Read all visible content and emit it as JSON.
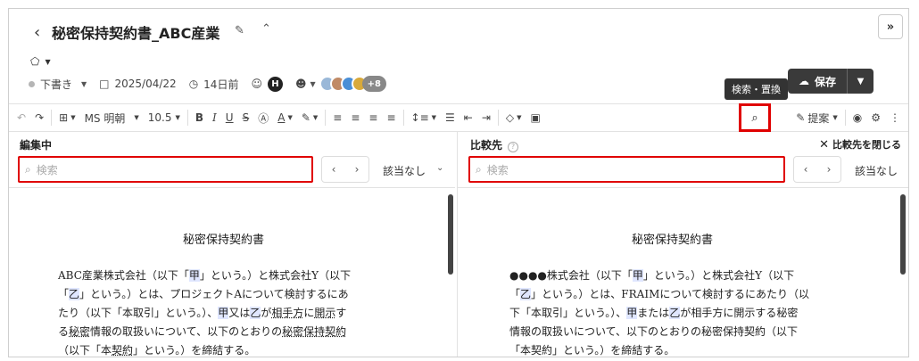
{
  "header": {
    "back_icon": "chevron-left-icon",
    "title": "秘密保持契約書_ABC産業",
    "expand_label": "»"
  },
  "meta": {
    "status": "下書き",
    "date": "2025/04/22",
    "relative": "14日前",
    "owner_initial": "H",
    "collaborators_more": "+8"
  },
  "actions": {
    "tooltip": "検索・置換",
    "save_label": "保存"
  },
  "toolbar": {
    "font_name": "MS 明朝",
    "font_size": "10.5",
    "proposal_label": "提案"
  },
  "left_pane": {
    "title": "編集中",
    "search_placeholder": "検索",
    "no_match": "該当なし",
    "doc_title": "秘密保持契約書"
  },
  "right_pane": {
    "title": "比較先",
    "close_label": "比較先を閉じる",
    "search_placeholder": "検索",
    "no_match": "該当なし",
    "doc_title": "秘密保持契約書"
  }
}
